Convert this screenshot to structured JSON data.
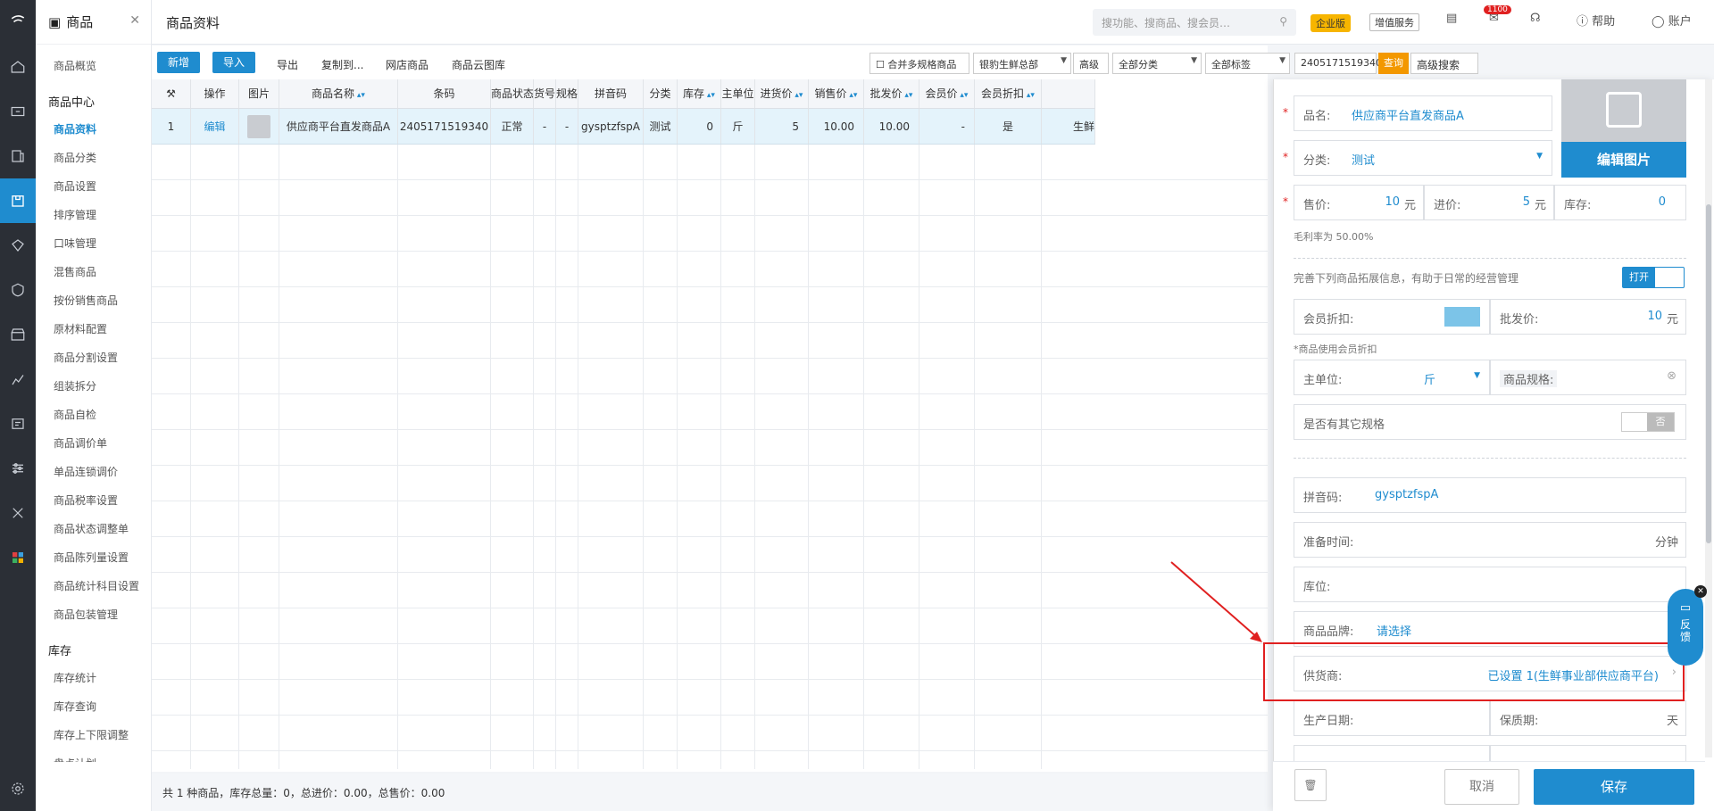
{
  "colors": {
    "accent": "#1f8ccf",
    "highlight": "#e02020",
    "enterprise_badge": "#f7b500",
    "query_button": "#f39800"
  },
  "nav": {
    "title": "商品",
    "groups": [
      {
        "label": "",
        "items": [
          "商品概览"
        ]
      },
      {
        "label": "商品中心",
        "items": [
          "商品资料",
          "商品分类",
          "商品设置",
          "排序管理",
          "口味管理",
          "混售商品",
          "按份销售商品",
          "原材料配置",
          "商品分割设置",
          "组装拆分",
          "商品自检",
          "商品调价单",
          "单品连锁调价",
          "商品税率设置",
          "商品状态调整单",
          "商品陈列量设置",
          "商品统计科目设置",
          "商品包装管理"
        ]
      },
      {
        "label": "库存",
        "items": [
          "库存统计",
          "库存查询",
          "库存上下限调整",
          "盘点计划"
        ]
      }
    ]
  },
  "header": {
    "title": "商品资料",
    "search_placeholder": "搜功能、搜商品、搜会员…",
    "enterprise_badge": "企业版",
    "value_service": "增值服务",
    "notification_count": "1100",
    "help": "帮助",
    "account": "账户"
  },
  "toolbar": {
    "new": "新增",
    "import": "导入",
    "export": "导出",
    "copy_to": "复制到...",
    "online_store": "网店商品",
    "cloud_library": "商品云图库",
    "merge_specs": "合并多规格商品",
    "store": "银豹生鲜总部",
    "advanced": "高级",
    "category": "全部分类",
    "tag": "全部标签",
    "search_value": "2405171519340",
    "query": "查询",
    "advanced_search": "高级搜索"
  },
  "table": {
    "columns": [
      "",
      "操作",
      "图片",
      "商品名称",
      "条码",
      "商品状态",
      "货号",
      "规格",
      "拼音码",
      "分类",
      "库存",
      "主单位",
      "进货价",
      "销售价",
      "批发价",
      "会员价",
      "会员折扣",
      ""
    ],
    "rows": [
      [
        "1",
        "编辑",
        "",
        "供应商平台直发商品A",
        "2405171519340",
        "正常",
        "-",
        "-",
        "gysptzfspA",
        "测试",
        "0",
        "斤",
        "5",
        "10.00",
        "10.00",
        "-",
        "是",
        "生鲜"
      ]
    ],
    "footer": "共 1 种商品，库存总量：0，总进价：0.00，总售价：0.00"
  },
  "form": {
    "name_label": "品名:",
    "name_value": "供应商平台直发商品A",
    "category_label": "分类:",
    "category_value": "测试",
    "edit_image": "编辑图片",
    "price_label": "售价:",
    "price_value": "10",
    "price_unit": "元",
    "cost_label": "进价:",
    "cost_value": "5",
    "cost_unit": "元",
    "stock_label": "库存:",
    "stock_value": "0",
    "margin_note": "毛利率为 50.00%",
    "extend_note": "完善下列商品拓展信息，有助于日常的经营管理",
    "extend_toggle": "打开",
    "member_discount_label": "会员折扣:",
    "wholesale_label": "批发价:",
    "wholesale_value": "10",
    "wholesale_unit": "元",
    "member_note": "*商品使用会员折扣",
    "unit_label": "主单位:",
    "unit_value": "斤",
    "spec_label": "商品规格:",
    "other_spec_label": "是否有其它规格",
    "other_spec_toggle": "否",
    "pinyin_label": "拼音码:",
    "pinyin_value": "gysptzfspA",
    "prep_label": "准备时间:",
    "prep_unit": "分钟",
    "location_label": "库位:",
    "brand_label": "商品品牌:",
    "brand_value": "请选择",
    "supplier_label": "供货商:",
    "supplier_value": "已设置 1(生鲜事业部供应商平台)",
    "production_label": "生产日期:",
    "shelf_label": "保质期:",
    "shelf_unit": "天",
    "cancel": "取消",
    "save": "保存"
  },
  "feedback": "反馈"
}
